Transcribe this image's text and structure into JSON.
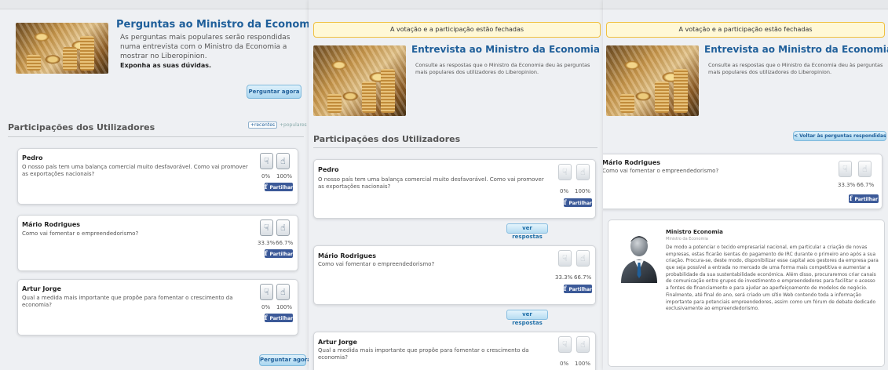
{
  "panel1": {
    "header_title": "Perguntas ao Ministro da Economia",
    "header_desc": "As perguntas mais populares serão respondidas numa entrevista com o Ministro da Economia a mostrar no Liberopinion.",
    "header_cta": "Exponha as suas dúvidas.",
    "ask_button": "Perguntar agora",
    "section_title": "Participações dos Utilizadores",
    "sort_recent": "+recentes",
    "sort_popular": "+populares",
    "questions": [
      {
        "name": "Pedro",
        "text": "O nosso país tem uma balança comercial muito desfavorável. Como vai promover as exportações nacionais?",
        "down_pct": "0%",
        "up_pct": "100%"
      },
      {
        "name": "Mário Rodrigues",
        "text": "Como vai fomentar o empreendedorismo?",
        "down_pct": "33.3%",
        "up_pct": "66.7%"
      },
      {
        "name": "Artur Jorge",
        "text": "Qual a medida mais importante que propõe para fomentar o crescimento da economia?",
        "down_pct": "0%",
        "up_pct": "100%"
      }
    ],
    "share_label": "Partilhar",
    "bottom_button": "Perguntar agora"
  },
  "panel2": {
    "notice": "A votação e a participação estão fechadas",
    "header_title": "Entrevista ao Ministro da Economia",
    "header_desc": "Consulte as respostas que o Ministro da Economia deu às perguntas mais populares dos utilizadores do Liberopinion.",
    "section_title": "Participações dos Utilizadores",
    "questions": [
      {
        "name": "Pedro",
        "text": "O nosso país tem uma balança comercial muito desfavorável. Como vai promover as exportações nacionais?",
        "down_pct": "0%",
        "up_pct": "100%"
      },
      {
        "name": "Mário Rodrigues",
        "text": "Como vai fomentar o empreendedorismo?",
        "down_pct": "33.3%",
        "up_pct": "66.7%"
      },
      {
        "name": "Artur Jorge",
        "text": "Qual a medida mais importante que propõe para fomentar o crescimento da economia?",
        "down_pct": "0%",
        "up_pct": "100%"
      }
    ],
    "share_label": "Partilhar",
    "answers_button": "ver respostas"
  },
  "panel3": {
    "notice": "A votação e a participação estão fechadas",
    "header_title": "Entrevista ao Ministro da Economia",
    "header_desc": "Consulte as respostas que o Ministro da Economia deu às perguntas mais populares dos utilizadores do Liberopinion.",
    "back_button": "< Voltar às perguntas respondidas",
    "question": {
      "name": "Mário Rodrigues",
      "text": "Como vai fomentar o empreendedorismo?",
      "down_pct": "33.3%",
      "up_pct": "66.7%"
    },
    "share_label": "Partilhar",
    "answer": {
      "author": "Ministro Economia",
      "role": "Ministro da Economia",
      "text": "De modo a potenciar o tecido empresarial nacional, em particular a criação de novas empresas, estas ficarão isentas do pagamento de IRC durante o primeiro ano após a sua criação. Procura-se, deste modo, disponibilizar esse capital aos gestores da empresa para que seja possível a entrada no mercado de uma forma mais competitiva e aumentar a probabilidade da sua sustentabilidade económica. Além disso, procuraremos criar canais de comunicação entre grupos de investimento e empreendedores para facilitar o acesso a fontes de financiamento e para ajudar ao aperfeiçoamento de modelos de negócio. Finalmente, até final do ano, será criado um sítio Web contendo toda a informação importante para potenciais empreendedores, assim como um fórum de debate dedicado exclusivamente ao empreendedorismo."
    }
  }
}
